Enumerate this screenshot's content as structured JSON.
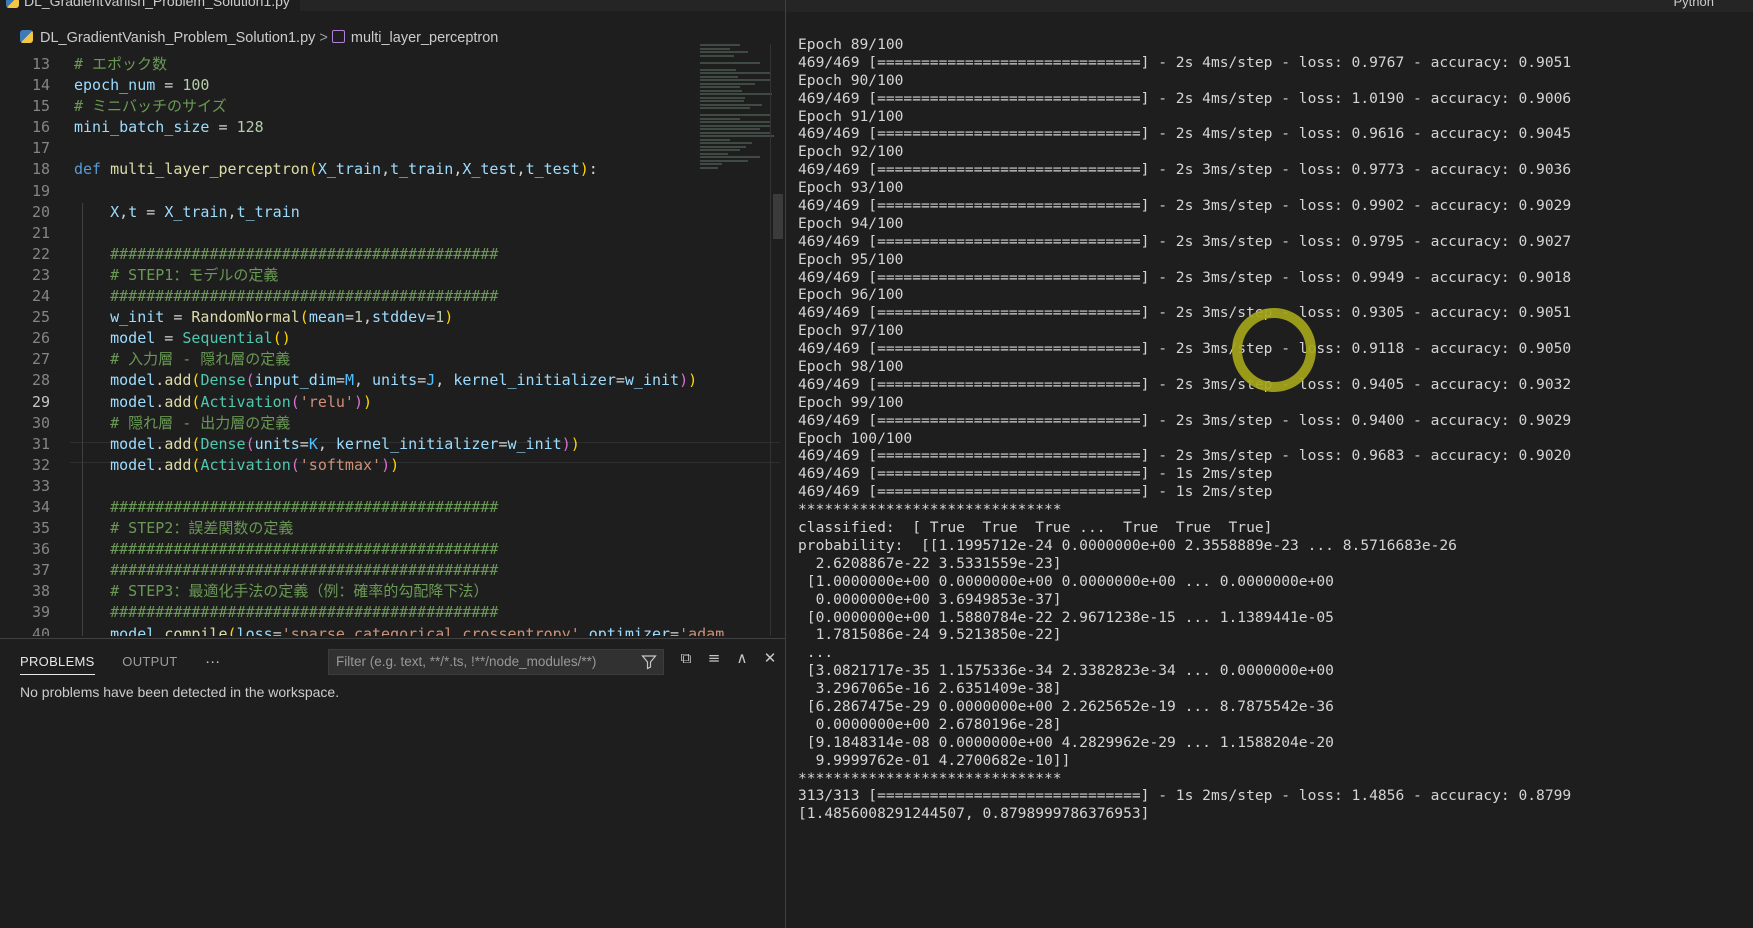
{
  "editor": {
    "tab_title": "DL_GradientVanish_Problem_Solution1.py",
    "breadcrumb": {
      "file": "DL_GradientVanish_Problem_Solution1.py",
      "symbol": "multi_layer_perceptron"
    },
    "current_line": 29,
    "lines": [
      {
        "n": "13",
        "html": "<span class=\"cm\"># エポック数</span>"
      },
      {
        "n": "14",
        "html": "<span class=\"var\">epoch_num</span> = <span class=\"num\">100</span>"
      },
      {
        "n": "15",
        "html": "<span class=\"cm\"># ミニバッチのサイズ</span>"
      },
      {
        "n": "16",
        "html": "<span class=\"var\">mini_batch_size</span> = <span class=\"num\">128</span>"
      },
      {
        "n": "17",
        "html": ""
      },
      {
        "n": "18",
        "html": "<span class=\"kw\">def</span> <span class=\"fn\">multi_layer_perceptron</span><span class=\"br1\">(</span><span class=\"var\">X_train</span>,<span class=\"var\">t_train</span>,<span class=\"var\">X_test</span>,<span class=\"var\">t_test</span><span class=\"br1\">)</span>:"
      },
      {
        "n": "19",
        "html": ""
      },
      {
        "n": "20",
        "html": "    <span class=\"var\">X</span>,<span class=\"var\">t</span> = <span class=\"var\">X_train</span>,<span class=\"var\">t_train</span>"
      },
      {
        "n": "21",
        "html": ""
      },
      {
        "n": "22",
        "html": "    <span class=\"cm\">###########################################</span>"
      },
      {
        "n": "23",
        "html": "    <span class=\"cm\"># STEP1：モデルの定義</span>"
      },
      {
        "n": "24",
        "html": "    <span class=\"cm\">###########################################</span>"
      },
      {
        "n": "25",
        "html": "    <span class=\"var\">w_init</span> = <span class=\"fn\">RandomNormal</span><span class=\"br1\">(</span><span class=\"var\">mean</span>=<span class=\"num\">1</span>,<span class=\"var\">stddev</span>=<span class=\"num\">1</span><span class=\"br1\">)</span>"
      },
      {
        "n": "26",
        "html": "    <span class=\"var\">model</span> = <span class=\"cls\">Sequential</span><span class=\"br1\">()</span>"
      },
      {
        "n": "27",
        "html": "    <span class=\"cm\"># 入力層 - 隠れ層の定義</span>"
      },
      {
        "n": "28",
        "html": "    <span class=\"var\">model</span>.<span class=\"fn\">add</span><span class=\"br1\">(</span><span class=\"cls\">Dense</span><span class=\"br2\">(</span><span class=\"var\">input_dim</span>=<span class=\"cst\">M</span>, <span class=\"var\">units</span>=<span class=\"cst\">J</span>, <span class=\"var\">kernel_initializer</span>=<span class=\"var\">w_init</span><span class=\"br2\">)</span><span class=\"br1\">)</span>"
      },
      {
        "n": "29",
        "html": "    <span class=\"var\">model</span>.<span class=\"fn\">add</span><span class=\"br1\">(</span><span class=\"cls\">Activation</span><span class=\"br2\">(</span><span class=\"str\">'relu'</span><span class=\"br2\">)</span><span class=\"br1\">)</span>"
      },
      {
        "n": "30",
        "html": "    <span class=\"cm\"># 隠れ層 - 出力層の定義</span>"
      },
      {
        "n": "31",
        "html": "    <span class=\"var\">model</span>.<span class=\"fn\">add</span><span class=\"br1\">(</span><span class=\"cls\">Dense</span><span class=\"br2\">(</span><span class=\"var\">units</span>=<span class=\"cst\">K</span>, <span class=\"var\">kernel_initializer</span>=<span class=\"var\">w_init</span><span class=\"br2\">)</span><span class=\"br1\">)</span>"
      },
      {
        "n": "32",
        "html": "    <span class=\"var\">model</span>.<span class=\"fn\">add</span><span class=\"br1\">(</span><span class=\"cls\">Activation</span><span class=\"br2\">(</span><span class=\"str\">'softmax'</span><span class=\"br2\">)</span><span class=\"br1\">)</span>"
      },
      {
        "n": "33",
        "html": ""
      },
      {
        "n": "34",
        "html": "    <span class=\"cm\">###########################################</span>"
      },
      {
        "n": "35",
        "html": "    <span class=\"cm\"># STEP2：誤差関数の定義</span>"
      },
      {
        "n": "36",
        "html": "    <span class=\"cm\">###########################################</span>"
      },
      {
        "n": "37",
        "html": "    <span class=\"cm\">###########################################</span>"
      },
      {
        "n": "38",
        "html": "    <span class=\"cm\"># STEP3：最適化手法の定義（例：確率的勾配降下法）</span>"
      },
      {
        "n": "39",
        "html": "    <span class=\"cm\">###########################################</span>"
      },
      {
        "n": "40",
        "html": "    <span class=\"var\">model</span>.<span class=\"fn\">compile</span><span class=\"br1\">(</span><span class=\"var\">loss</span>=<span class=\"str\">'sparse_categorical_crossentropy'</span>,<span class=\"var\">optimizer</span>=<span class=\"str\">'adam</span>"
      }
    ]
  },
  "panel": {
    "tabs": [
      "PROBLEMS",
      "OUTPUT"
    ],
    "more": "···",
    "filter_placeholder": "Filter (e.g. text, **/*.ts, !**/node_modules/**)",
    "message": "No problems have been detected in the workspace."
  },
  "output_header": "Python",
  "output": [
    "Epoch 89/100",
    "469/469 [==============================] - 2s 4ms/step - loss: 0.9767 - accuracy: 0.9051",
    "Epoch 90/100",
    "469/469 [==============================] - 2s 4ms/step - loss: 1.0190 - accuracy: 0.9006",
    "Epoch 91/100",
    "469/469 [==============================] - 2s 4ms/step - loss: 0.9616 - accuracy: 0.9045",
    "Epoch 92/100",
    "469/469 [==============================] - 2s 3ms/step - loss: 0.9773 - accuracy: 0.9036",
    "Epoch 93/100",
    "469/469 [==============================] - 2s 3ms/step - loss: 0.9902 - accuracy: 0.9029",
    "Epoch 94/100",
    "469/469 [==============================] - 2s 3ms/step - loss: 0.9795 - accuracy: 0.9027",
    "Epoch 95/100",
    "469/469 [==============================] - 2s 3ms/step - loss: 0.9949 - accuracy: 0.9018",
    "Epoch 96/100",
    "469/469 [==============================] - 2s 3ms/step - loss: 0.9305 - accuracy: 0.9051",
    "Epoch 97/100",
    "469/469 [==============================] - 2s 3ms/step - loss: 0.9118 - accuracy: 0.9050",
    "Epoch 98/100",
    "469/469 [==============================] - 2s 3ms/step - loss: 0.9405 - accuracy: 0.9032",
    "Epoch 99/100",
    "469/469 [==============================] - 2s 3ms/step - loss: 0.9400 - accuracy: 0.9029",
    "Epoch 100/100",
    "469/469 [==============================] - 2s 3ms/step - loss: 0.9683 - accuracy: 0.9020",
    "469/469 [==============================] - 1s 2ms/step",
    "469/469 [==============================] - 1s 2ms/step",
    "******************************",
    "classified:  [ True  True  True ...  True  True  True]",
    "probability:  [[1.1995712e-24 0.0000000e+00 2.3558889e-23 ... 8.5716683e-26",
    "  2.6208867e-22 3.5331559e-23]",
    " [1.0000000e+00 0.0000000e+00 0.0000000e+00 ... 0.0000000e+00",
    "  0.0000000e+00 3.6949853e-37]",
    " [0.0000000e+00 1.5880784e-22 2.9671238e-15 ... 1.1389441e-05",
    "  1.7815086e-24 9.5213850e-22]",
    " ...",
    " [3.0821717e-35 1.1575336e-34 2.3382823e-34 ... 0.0000000e+00",
    "  3.2967065e-16 2.6351409e-38]",
    " [6.2867475e-29 0.0000000e+00 2.2625652e-19 ... 8.7875542e-36",
    "  0.0000000e+00 2.6780196e-28]",
    " [9.1848314e-08 0.0000000e+00 4.2829962e-29 ... 1.1588204e-20",
    "  9.9999762e-01 4.2700682e-10]]",
    "******************************",
    "313/313 [==============================] - 1s 2ms/step - loss: 1.4856 - accuracy: 0.8799",
    "[1.4856008291244507, 0.8798999786376953]"
  ],
  "colors": {
    "highlight_circle": "#a5a51a"
  }
}
